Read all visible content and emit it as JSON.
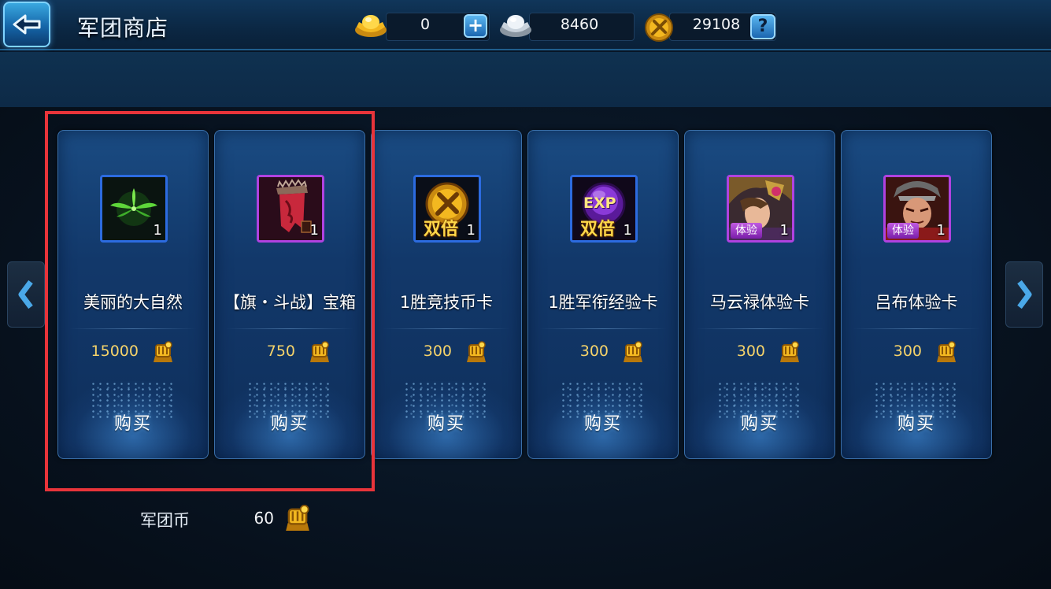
{
  "header": {
    "title": "军团商店",
    "gold_ingot": {
      "value": "0",
      "icon": "gold-ingot-icon"
    },
    "silver_ingot": {
      "value": "8460",
      "icon": "silver-ingot-icon"
    },
    "medal": {
      "value": "29108",
      "icon": "medal-coin-icon"
    },
    "plus_label": "+",
    "help_label": "?"
  },
  "shop": {
    "items": [
      {
        "name": "美丽的大自然",
        "qty": "1",
        "price": "15000",
        "frame": "blue",
        "icon": "green-leaf-icon",
        "buy_label": "购买"
      },
      {
        "name": "【旗・斗战】宝箱",
        "qty": "1",
        "price": "750",
        "frame": "purple",
        "icon": "banner-chest-icon",
        "buy_label": "购买"
      },
      {
        "name": "1胜竞技币卡",
        "qty": "1",
        "price": "300",
        "frame": "blue",
        "icon": "double-arena-coin-icon",
        "badge": "双倍",
        "buy_label": "购买"
      },
      {
        "name": "1胜军衔经验卡",
        "qty": "1",
        "price": "300",
        "frame": "blue",
        "icon": "double-exp-icon",
        "badge": "双倍",
        "badge_top": "EXP",
        "buy_label": "购买"
      },
      {
        "name": "马云禄体验卡",
        "qty": "1",
        "price": "300",
        "frame": "purple",
        "icon": "hero-portrait-icon",
        "badge": "体验",
        "buy_label": "购买"
      },
      {
        "name": "吕布体验卡",
        "qty": "1",
        "price": "300",
        "frame": "purple",
        "icon": "hero-portrait-icon",
        "badge": "体验",
        "buy_label": "购买"
      }
    ]
  },
  "footer": {
    "label": "军团币",
    "value": "60"
  },
  "colors": {
    "price_gold": "#f5d36a",
    "highlight_red": "#e8343a",
    "card_blue": "#1a4b82"
  }
}
